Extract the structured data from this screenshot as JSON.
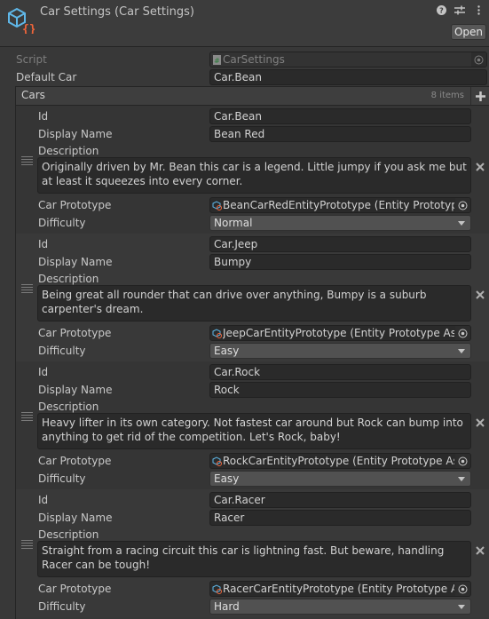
{
  "header": {
    "title": "Car Settings (Car Settings)",
    "open_label": "Open",
    "icons": [
      "help-icon",
      "presets-icon",
      "more-menu-icon"
    ]
  },
  "script_field": {
    "label": "Script",
    "value": "CarSettings"
  },
  "default_car": {
    "label": "Default Car",
    "value": "Car.Bean"
  },
  "cars_list": {
    "title": "Cars",
    "count": "8 items",
    "field_labels": {
      "id": "Id",
      "display_name": "Display Name",
      "description": "Description",
      "car_prototype": "Car Prototype",
      "difficulty": "Difficulty"
    },
    "items": [
      {
        "id": "Car.Bean",
        "display_name": "Bean Red",
        "description": "Originally driven by Mr. Bean this car is a legend. Little jumpy if you ask me but at least it squeezes into every corner.",
        "car_prototype": "BeanCarRedEntityPrototype (Entity Prototype Asset)",
        "difficulty": "Normal"
      },
      {
        "id": "Car.Jeep",
        "display_name": "Bumpy",
        "description": "Being great all rounder that can drive over anything, Bumpy is a suburb carpenter's dream.",
        "car_prototype": "JeepCarEntityPrototype (Entity Prototype Asset)",
        "difficulty": "Easy"
      },
      {
        "id": "Car.Rock",
        "display_name": "Rock",
        "description": "Heavy lifter in its own category. Not fastest car around but Rock can bump into anything to get rid of the competition. Let's Rock, baby!",
        "car_prototype": "RockCarEntityPrototype (Entity Prototype Asset)",
        "difficulty": "Easy"
      },
      {
        "id": "Car.Racer",
        "display_name": "Racer",
        "description": "Straight from a racing circuit this car is lightning fast. But beware, handling Racer can be tough!",
        "car_prototype": "RacerCarEntityPrototype (Entity Prototype Asset)",
        "difficulty": "Hard"
      }
    ]
  }
}
